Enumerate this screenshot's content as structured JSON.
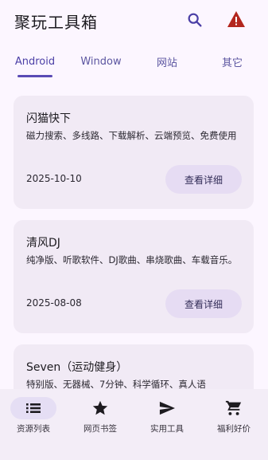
{
  "app": {
    "title": "聚玩工具箱"
  },
  "tabs": [
    {
      "label": "Android",
      "active": true
    },
    {
      "label": "Window",
      "active": false
    },
    {
      "label": "网站",
      "active": false
    },
    {
      "label": "其它",
      "active": false
    }
  ],
  "cards": [
    {
      "title": "闪猫快下",
      "description": "磁力搜索、多线路、下载解析、云端预览、免费使用",
      "date": "2025-10-10",
      "button": "查看详细"
    },
    {
      "title": "清风DJ",
      "description": "纯净版、听歌软件、DJ歌曲、串烧歌曲、车载音乐。",
      "date": "2025-08-08",
      "button": "查看详细"
    },
    {
      "title": "Seven（运动健身）",
      "description": "特别版、无器械、7分钟、科学循环、真人语"
    }
  ],
  "bottom_nav": [
    {
      "label": "资源列表",
      "icon": "list-icon",
      "active": true
    },
    {
      "label": "网页书签",
      "icon": "star-icon",
      "active": false
    },
    {
      "label": "实用工具",
      "icon": "send-icon",
      "active": false
    },
    {
      "label": "福利好价",
      "icon": "cart-icon",
      "active": false
    }
  ],
  "colors": {
    "background": "#FCF6FF",
    "card": "#F1EAF5",
    "accent": "#5A4BB5",
    "warning": "#B3261E",
    "button": "#E6DCF3",
    "nav_bar": "#F3EDF7"
  }
}
